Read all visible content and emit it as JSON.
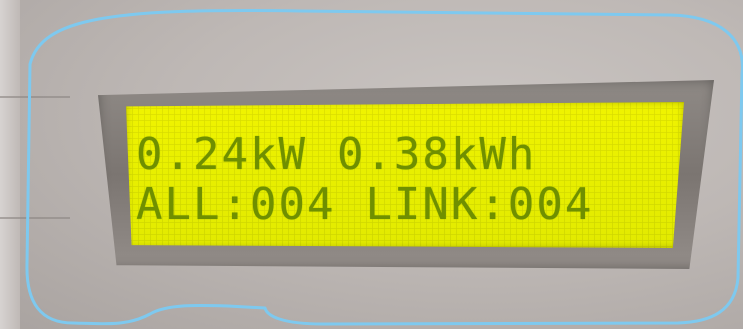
{
  "display": {
    "power": "0.24kW",
    "energy": "0.38kWh",
    "all_count": "ALL:004",
    "link_count": "LINK:004"
  },
  "colors": {
    "lcd_background": "#e8ef00",
    "lcd_text": "#6f8f00",
    "outline": "#7ec9ef"
  }
}
